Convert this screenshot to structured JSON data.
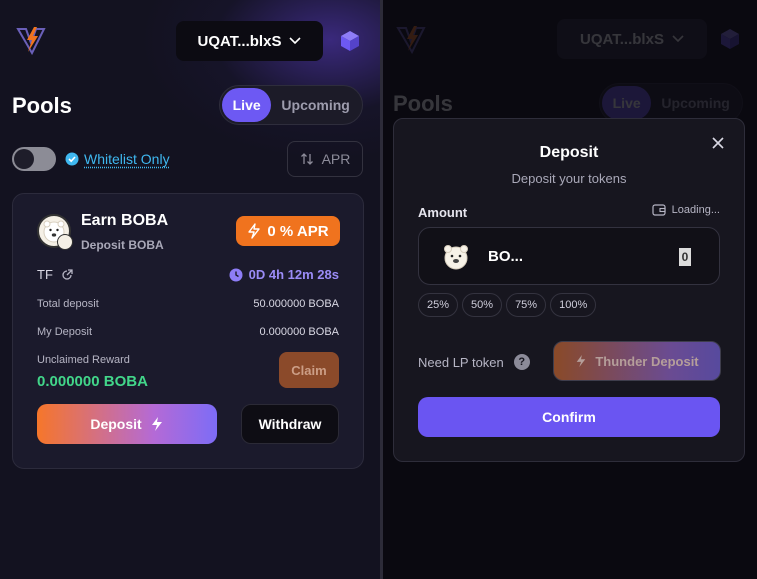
{
  "header": {
    "wallet_address": "UQAT...blxS"
  },
  "pools": {
    "title": "Pools",
    "tabs": [
      {
        "label": "Live",
        "active": true
      },
      {
        "label": "Upcoming",
        "active": false
      }
    ],
    "whitelist_label": "Whitelist Only",
    "whitelist_toggle_on": false,
    "sort_label": "APR"
  },
  "pool_card": {
    "title": "Earn BOBA",
    "subtitle": "Deposit BOBA",
    "apr_badge": "0 % APR",
    "project_code": "TF",
    "countdown": "0D 4h 12m 28s",
    "total_deposit_label": "Total deposit",
    "total_deposit_value": "50.000000 BOBA",
    "my_deposit_label": "My Deposit",
    "my_deposit_value": "0.000000 BOBA",
    "unclaimed_label": "Unclaimed Reward",
    "unclaimed_value": "0.000000 BOBA",
    "claim_label": "Claim",
    "deposit_label": "Deposit",
    "withdraw_label": "Withdraw"
  },
  "deposit_modal": {
    "title": "Deposit",
    "subtitle": "Deposit your tokens",
    "amount_label": "Amount",
    "balance_status": "Loading...",
    "token_name": "BO...",
    "amount_value": "0",
    "percent_options": [
      "25%",
      "50%",
      "75%",
      "100%"
    ],
    "need_lp_label": "Need LP token",
    "thunder_deposit_label": "Thunder Deposit",
    "confirm_label": "Confirm"
  },
  "colors": {
    "accent": "#6d59f3",
    "apr_orange": "#f0731e",
    "reward_green": "#42d68a",
    "whitelist_blue": "#3fb8f0"
  },
  "icons": [
    "logo-lightning-icon",
    "chevron-down-icon",
    "cube-icon",
    "verified-check-icon",
    "sort-arrows-icon",
    "bolt-icon",
    "external-link-icon",
    "clock-icon",
    "close-icon",
    "wallet-icon",
    "help-icon"
  ]
}
